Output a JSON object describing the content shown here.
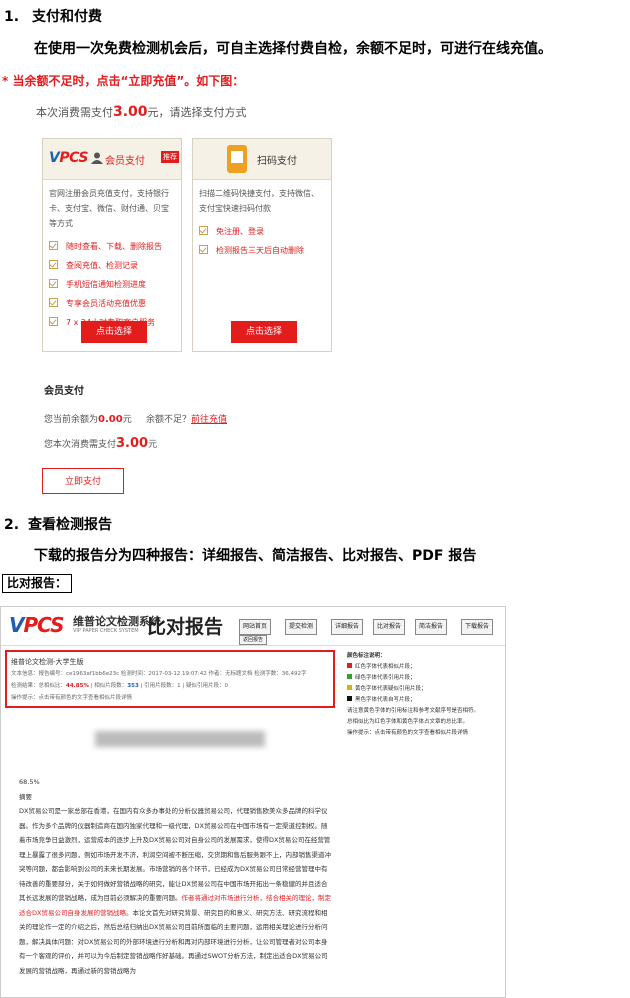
{
  "section1": {
    "number": "1.",
    "title": "支付和付费",
    "intro": "在使用一次免费检测机会后，可自主选择付费自检，余额不足时，可进行在线充值。",
    "note": "*  当余额不足时，点击“立即充值”。如下图："
  },
  "payment": {
    "line_prefix": "本次消费需支付",
    "line_amount": "3.00",
    "line_suffix": "元，请选择支付方式",
    "member_card": {
      "logo_v": "V",
      "logo_rest": "PCS",
      "title": "会员支付",
      "tag": "推荐",
      "description": "官网注册会员充值支付，支持银行卡、支付宝、微信、财付通、贝宝等方式",
      "features": [
        "随时查看、下载、删除报告",
        "查阅充值、检测记录",
        "手机短信通知检测进度",
        "专享会员活动充值优惠",
        "7 x 24小时专职客户服务"
      ],
      "button": "点击选择"
    },
    "scan_card": {
      "title": "扫码支付",
      "description": "扫描二维码快捷支付，支持微信、支付宝快速扫码付款",
      "features": [
        "免注册、登录",
        "检测报告三天后自动删除"
      ],
      "button": "点击选择"
    }
  },
  "member_pay": {
    "title": "会员支付",
    "balance_prefix": "您当前余额为",
    "balance_amount": "0.00",
    "balance_unit": "元",
    "insufficient": "余额不足？",
    "recharge_link": "前往充值",
    "consume_prefix": "您本次消费需支付",
    "consume_amount": "3.00",
    "consume_unit": "元",
    "pay_button": "立即支付"
  },
  "section2": {
    "number": "2.",
    "title": "查看检测报告",
    "intro": "下载的报告分为四种报告：详细报告、简洁报告、比对报告、PDF 报告",
    "compare_label": "比对报告："
  },
  "report": {
    "logo_v": "V",
    "logo_rest": "PCS",
    "system_name": "维普论文检测系统",
    "system_en": "VIP PAPER CHECK SYSTEM",
    "big_title": "比对报告",
    "nav": [
      "网站首页",
      "提交检测",
      "详细报告",
      "比对报告",
      "简洁报告",
      "下载报告",
      "返回报告"
    ],
    "meta_title": "维普论文检测-大学生版",
    "meta_line1": "文本信息：报告编号：ce1963af1bb6e23c    检测时间：2017-03-12 19:07:42    作者：无标题文档    检测字数：36,492字",
    "meta_line2_prefix": "检测结果：总相似比：",
    "meta_similarity": "44.85%",
    "meta_line2_mid": "| 相似片段数：",
    "meta_fragments": "353",
    "meta_line2_suffix": "| 引用片段数：1  | 疑似引用片段：0",
    "meta_line3": "操作提示：点击带有颜色的文字查看相似片段详情",
    "legend_title": "颜色标注说明：",
    "legend": [
      {
        "color": "#e31c1c",
        "text": "红色字体代表相似片段；"
      },
      {
        "color": "#2aa52a",
        "text": "绿色字体代表引用片段；"
      },
      {
        "color": "#e0b000",
        "text": "黄色字体代表疑似引用片段；"
      },
      {
        "color": "#111111",
        "text": "黑色字体代表自写片段；"
      }
    ],
    "legend_extra": [
      "请注意黄色字体的引用标注和参考文献序号是否相符。",
      "总相似比为红色字体和黄色字体占文章的总比率。",
      "操作提示：点击带有颜色的文字查看相似片段详情"
    ],
    "body_percent": "68.5%",
    "body_heading": "摘要",
    "body_text_1": "DX贸易公司是一家总部在香港，在国内有众多办事处的分析仪器贸易公司，代理销售欧美众多品牌的科学仪器。作为多个品牌的仪器制造商在国内独家代理和一级代理，DX贸易公司在中国市场有一定渠道控制权。随着市场竞争日益激烈，运营成本的逐步上升及DX贸易公司对自身公司的发展需求，使得DX贸易公司在经营管理上暴露了很多问题，例如市场开发不济，利润空间被不断压缩，交货期和售后服务跟不上，内部销售渠道冲突等问题，都会影响到公司的未来长期发展。市场营销的各个环节，已经成为DX贸易公司日常经营管理中有待改善的重要部分，关于如何做好营销战略的研究，能让DX贸易公司在中国市场开拓出一条稳健的并且适合其长远发展的营销战略，成为目前必须解决的重要问题。",
    "body_red": "作者将通过对市场进行分析，结合相关的理论，制定适合DX贸易公司自身发展的营销战略。",
    "body_text_2": "本论文首先对研究背景、研究目的和意义、研究方法、研究流程和相关的理论作一定的介绍之后，然后总结归纳出DX贸易公司目前所面临的主要问题，运用相关理论进行分析问题，解决具体问题：对DX贸易公司的外部环境进行分析和再对内部环境进行分析，让公司管理者对公司本身有一个客观的评价，并可以为今后制定营销战略作好基础。再通过SWOT分析方法，制定出适合DX贸易公司发展的营销战略，再通过新的营销战略为"
  }
}
